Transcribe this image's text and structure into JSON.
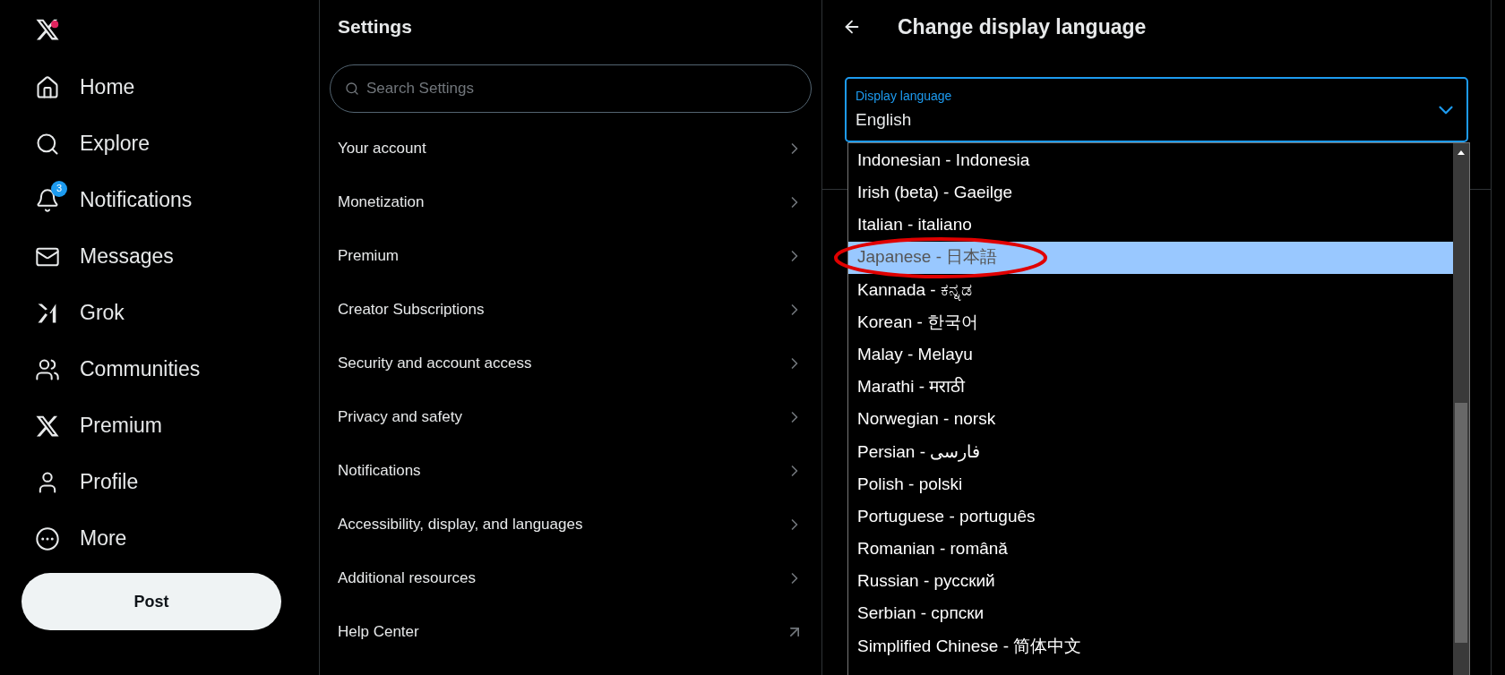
{
  "nav": {
    "items": [
      {
        "label": "Home"
      },
      {
        "label": "Explore"
      },
      {
        "label": "Notifications",
        "badge": "3"
      },
      {
        "label": "Messages"
      },
      {
        "label": "Grok"
      },
      {
        "label": "Communities"
      },
      {
        "label": "Premium"
      },
      {
        "label": "Profile"
      },
      {
        "label": "More"
      }
    ],
    "post_button": "Post"
  },
  "settings": {
    "title": "Settings",
    "search": {
      "placeholder": "Search Settings"
    },
    "items": [
      {
        "label": "Your account",
        "kind": "chevron"
      },
      {
        "label": "Monetization",
        "kind": "chevron"
      },
      {
        "label": "Premium",
        "kind": "chevron"
      },
      {
        "label": "Creator Subscriptions",
        "kind": "chevron"
      },
      {
        "label": "Security and account access",
        "kind": "chevron"
      },
      {
        "label": "Privacy and safety",
        "kind": "chevron"
      },
      {
        "label": "Notifications",
        "kind": "chevron"
      },
      {
        "label": "Accessibility, display, and languages",
        "kind": "chevron"
      },
      {
        "label": "Additional resources",
        "kind": "chevron"
      },
      {
        "label": "Help Center",
        "kind": "external"
      }
    ]
  },
  "detail": {
    "title": "Change display language",
    "select": {
      "label": "Display language",
      "value": "English"
    },
    "options": [
      {
        "label": "Indonesian - Indonesia",
        "selected": false
      },
      {
        "label": "Irish (beta) - Gaeilge",
        "selected": false
      },
      {
        "label": "Italian - italiano",
        "selected": false
      },
      {
        "label": "Japanese - 日本語",
        "selected": true
      },
      {
        "label": "Kannada - ಕನ್ನಡ",
        "selected": false
      },
      {
        "label": "Korean - 한국어",
        "selected": false
      },
      {
        "label": "Malay - Melayu",
        "selected": false
      },
      {
        "label": "Marathi - मराठी",
        "selected": false
      },
      {
        "label": "Norwegian - norsk",
        "selected": false
      },
      {
        "label": "Persian - فارسی",
        "selected": false
      },
      {
        "label": "Polish - polski",
        "selected": false
      },
      {
        "label": "Portuguese - português",
        "selected": false
      },
      {
        "label": "Romanian - română",
        "selected": false
      },
      {
        "label": "Russian - русский",
        "selected": false
      },
      {
        "label": "Serbian - српски",
        "selected": false
      },
      {
        "label": "Simplified Chinese - 简体中文",
        "selected": false
      }
    ]
  }
}
